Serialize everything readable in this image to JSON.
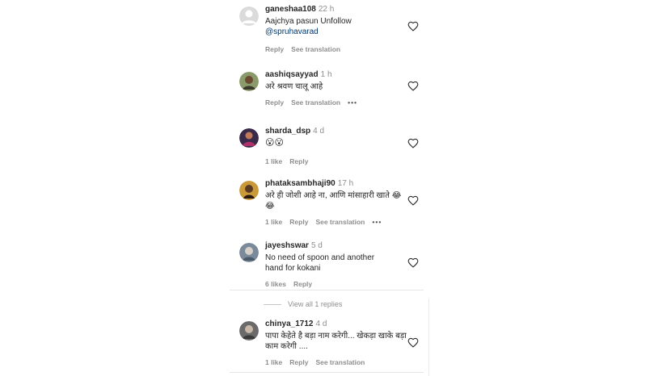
{
  "comments": [
    {
      "user": "ganeshaa108",
      "time": "22 h",
      "text": "Aajchya pasun Unfollow",
      "mention": "@spruhavarad",
      "actions": [
        "Reply",
        "See translation"
      ]
    },
    {
      "user": "aashiqsayyad",
      "time": "1 h",
      "text": "अरे श्रवण चालू आहे",
      "actions": [
        "Reply",
        "See translation"
      ],
      "more": "•••"
    },
    {
      "user": "sharda_dsp",
      "time": "4 d",
      "text": "😮😮",
      "actions": [
        "1 like",
        "Reply"
      ]
    },
    {
      "user": "phataksambhaji90",
      "time": "17 h",
      "text": "अरे ही जोशी आहे ना, आणि मांसाहारी खाते 😂😂",
      "actions": [
        "1 like",
        "Reply",
        "See translation"
      ],
      "more": "•••"
    },
    {
      "user": "jayeshswar",
      "time": "5 d",
      "text": "No need of spoon and another hand for kokani",
      "actions": [
        "6 likes",
        "Reply"
      ]
    },
    {
      "user": "chinya_1712",
      "time": "4 d",
      "text": "पापा केहेते है बड़ा नाम करेगी... खेकड़ा खाके बड़ा काम करेगी ....",
      "actions": [
        "1 like",
        "Reply",
        "See translation"
      ]
    }
  ],
  "view_replies": "View all 1 replies",
  "icons": {
    "like": "heart-outline-icon",
    "more": "more-horizontal-icon"
  }
}
